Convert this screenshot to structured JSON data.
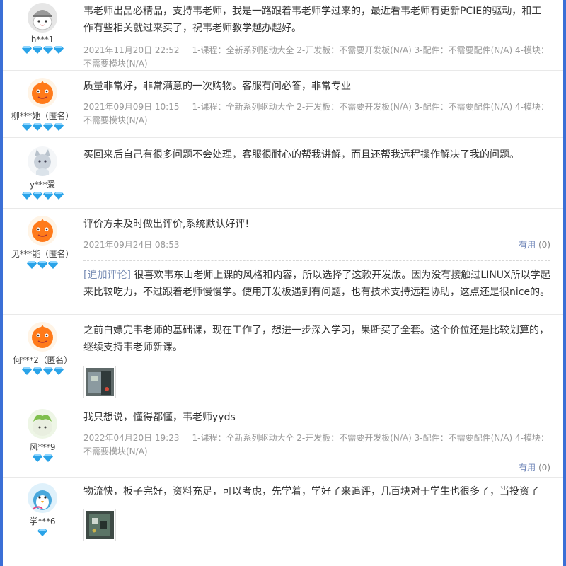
{
  "reviews": [
    {
      "user": "h***1",
      "gems": 4,
      "avatar": "cartoon-cap",
      "text": "韦老师出品必精品，支持韦老师，我是一路跟着韦老师学过来的，最近看韦老师有更新PCIE的驱动，和工作有些相关就过来买了，祝韦老师教学越办越好。",
      "date": "2021年11月20日 22:52",
      "spec": "1-课程：全新系列驱动大全  2-开发板：不需要开发板(N/A)  3-配件：不需要配件(N/A)  4-模块：不需要模块(N/A)"
    },
    {
      "user": "柳***她（匿名）",
      "gems": 4,
      "avatar": "orange-default",
      "text": "质量非常好，非常满意的一次购物。客服有问必答，非常专业",
      "date": "2021年09月09日 10:15",
      "spec": "1-课程：全新系列驱动大全  2-开发板：不需要开发板(N/A)  3-配件：不需要配件(N/A)  4-模块：不需要模块(N/A)"
    },
    {
      "user": "y***爱",
      "gems": 4,
      "avatar": "cat",
      "text": "买回来后自己有很多问题不会处理，客服很耐心的帮我讲解，而且还帮我远程操作解决了我的问题。"
    },
    {
      "user": "见***能（匿名）",
      "gems": 3,
      "avatar": "orange-default",
      "text": "评价方未及时做出评价,系统默认好评!",
      "date": "2021年09月24日 08:53",
      "useful_label": "有用",
      "useful_count": "(0)",
      "append_label": "[追加评论]",
      "append_text": "很喜欢韦东山老师上课的风格和内容，所以选择了这款开发版。因为没有接触过LINUX所以学起来比较吃力，不过跟着老师慢慢学。使用开发板遇到有问题，也有技术支持远程协助，这点还是很nice的。"
    },
    {
      "user": "何***2（匿名）",
      "gems": 4,
      "avatar": "orange-default",
      "text": "之前白嫖完韦老师的基础课，现在工作了，想进一步深入学习，果断买了全套。这个价位还是比较划算的，继续支持韦老师新课。"
    },
    {
      "user": "风***9",
      "gems": 2,
      "avatar": "green-plant",
      "text": "我只想说，懂得都懂，韦老师yyds",
      "date": "2022年04月20日 19:23",
      "spec": "1-课程：全新系列驱动大全  2-开发板：不需要开发板(N/A)  3-配件：不需要配件(N/A)  4-模块：不需要模块(N/A)",
      "useful_label": "有用",
      "useful_count": "(0)"
    },
    {
      "user": "学***6",
      "gems": 1,
      "avatar": "penguin",
      "text": "物流快，板子完好，资料充足，可以考虑，先学着，学好了来追评，几百块对于学生也很多了，当投资了"
    }
  ],
  "colors": {
    "frame": "#3b6fd6",
    "gem": "#2aa3e8",
    "link": "#6f86b8",
    "meta": "#9a9a9a"
  }
}
